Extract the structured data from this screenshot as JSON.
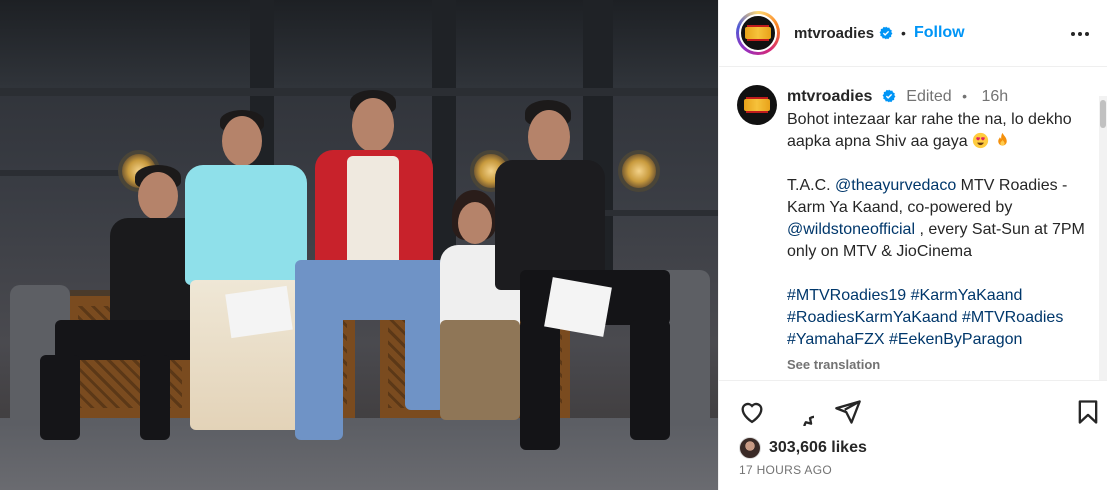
{
  "post": {
    "username": "mtvroadies",
    "follow_label": "Follow",
    "separator": "•"
  },
  "caption": {
    "username": "mtvroadies",
    "edited": "Edited",
    "separator": "•",
    "time": "16h",
    "line1": "Bohot intezaar kar rahe the na, lo dekho aapka apna Shiv aa gaya",
    "tac_prefix": "T.A.C. ",
    "mention1": "@theayurvedaco",
    "tac_middle": " MTV Roadies - Karm Ya Kaand, co-powered by ",
    "mention2": "@wildstoneofficial",
    "tac_suffix": " , every Sat-Sun at 7PM only on MTV & JioCinema",
    "hashtags": [
      "#MTVRoadies19",
      "#KarmYaKaand",
      "#RoadiesKarmYaKaand",
      "#MTVRoadies",
      "#YamahaFZX",
      "#EekenByParagon"
    ],
    "see_translation": "See translation"
  },
  "actions": {
    "likes": "303,606 likes",
    "timestamp": "17 HOURS AGO"
  },
  "icons": {
    "verified": "verified-badge-icon",
    "more": "more-options-icon",
    "like": "heart-icon",
    "comment": "comment-icon",
    "share": "share-icon",
    "save": "bookmark-icon"
  },
  "colors": {
    "accent": "#0095f6",
    "link": "#00376b",
    "muted": "#737373",
    "text": "#262626"
  }
}
